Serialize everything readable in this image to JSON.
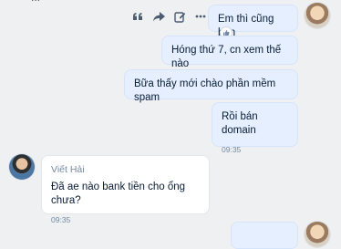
{
  "top_fragment": "...",
  "messages": [
    {
      "text": "Em thì cũng bận"
    },
    {
      "text": "Hóng thứ 7, cn xem thế nào"
    },
    {
      "text": "Bữa thấy mới chào phần mềm spam"
    },
    {
      "text": "Rồi bán domain",
      "time": "09:35"
    },
    {
      "sender": "Viết Hải",
      "text": "Đã ae nào bank tiền cho ổng chưa?",
      "time": "09:35"
    }
  ],
  "icons": {
    "quote": "quote-icon",
    "forward": "share-icon",
    "edit": "edit-icon",
    "more": "more-icon",
    "like": "like-icon"
  }
}
